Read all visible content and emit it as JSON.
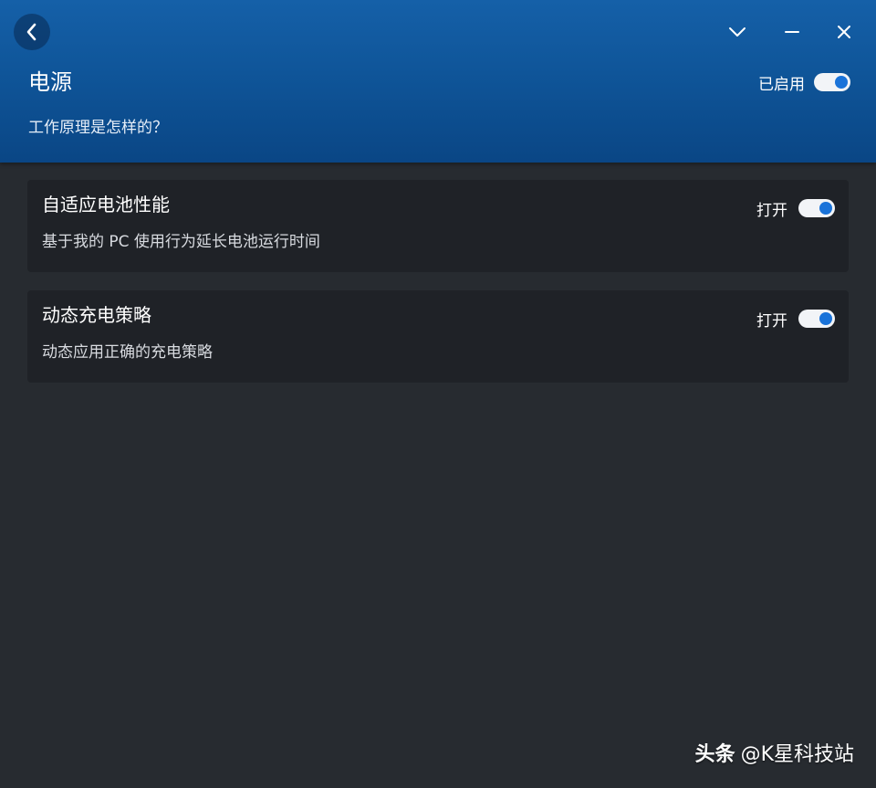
{
  "header": {
    "title": "电源",
    "enabled_label": "已启用",
    "enabled": true,
    "how_it_works": "工作原理是怎样的？"
  },
  "window_controls": {
    "back_icon": "chevron-left-icon",
    "collapse_icon": "chevron-down-icon",
    "minimize_icon": "minimize-icon",
    "close_icon": "close-icon"
  },
  "settings": [
    {
      "title": "自适应电池性能",
      "description": "基于我的 PC 使用行为延长电池运行时间",
      "toggle_label": "打开",
      "enabled": true
    },
    {
      "title": "动态充电策略",
      "description": "动态应用正确的充电策略",
      "toggle_label": "打开",
      "enabled": true
    }
  ],
  "watermark": {
    "brand": "头条",
    "handle": "@K星科技站"
  },
  "colors": {
    "header_top": "#1560a8",
    "header_bottom": "#0a4685",
    "background": "#272b30",
    "card": "#1f2227",
    "toggle_on": "#1a73d9"
  }
}
